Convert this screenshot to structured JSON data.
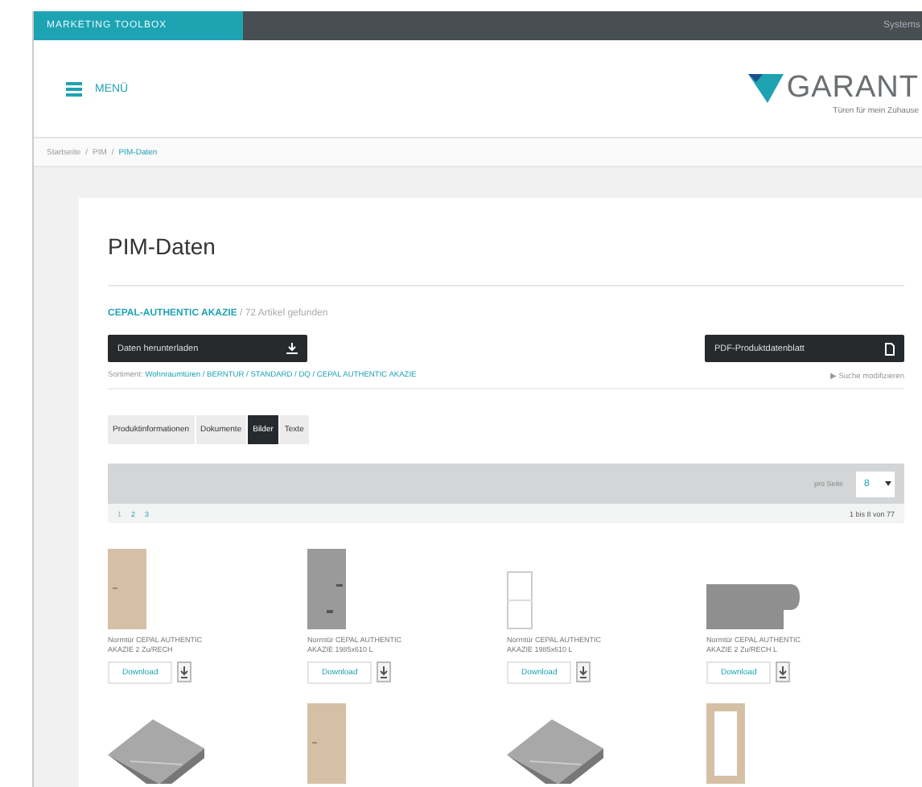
{
  "topbar": {
    "brand": "MARKETING TOOLBOX",
    "right_text": "Systems"
  },
  "header": {
    "menu_label": "MENÜ",
    "logo_text": "GARANT",
    "tagline": "Türen für mein Zuhause"
  },
  "breadcrumb_separator": "/",
  "breadcrumb": [
    {
      "label": "Startseite",
      "current": false
    },
    {
      "label": "PIM",
      "current": false
    },
    {
      "label": "PIM-Daten",
      "current": true
    }
  ],
  "page": {
    "title": "PIM-Daten",
    "product_name": "CEPAL-AUTHENTIC AKAZIE",
    "result_count": "/ 72 Artikel gefunden",
    "download_button": "Daten herunterladen",
    "pdf_button": "PDF-Produktdatenblatt",
    "assortment_label": "Sortiment:",
    "assortment_path": "Wohnraumtüren / BERNTUR / STANDARD / DQ / CEPAL AUTHENTIC AKAZIE",
    "modify_search": "▶ Suche modifizieren"
  },
  "tabs": [
    {
      "label": "Produktinformationen",
      "selected": false
    },
    {
      "label": "Dokumente",
      "selected": false
    },
    {
      "label": "Bilder",
      "selected": true
    },
    {
      "label": "Texte",
      "selected": false
    }
  ],
  "pager": {
    "per_page_label": "pro Seite",
    "per_page_value": "8",
    "pages": [
      {
        "label": "1",
        "selected": true
      },
      {
        "label": "2",
        "selected": false
      },
      {
        "label": "3",
        "selected": false
      }
    ],
    "range": "1 bis 8 von 77"
  },
  "products": [
    {
      "kind": "door-wood",
      "caption": "Normtür CEPAL AUTHENTIC AKAZIE 2 Zu/RECH",
      "button": "Download"
    },
    {
      "kind": "door-gray",
      "caption": "Normtür CEPAL AUTHENTIC AKAZIE 1985x610 L",
      "button": "Download"
    },
    {
      "kind": "door-outline",
      "caption": "Normtür CEPAL AUTHENTIC AKAZIE 1985x610 L",
      "button": "Download"
    },
    {
      "kind": "profile",
      "caption": "Normtür CEPAL AUTHENTIC AKAZIE 2 Zu/RECH L",
      "button": "Download"
    },
    {
      "kind": "slab"
    },
    {
      "kind": "door-wood"
    },
    {
      "kind": "slab"
    },
    {
      "kind": "door-glass"
    }
  ]
}
